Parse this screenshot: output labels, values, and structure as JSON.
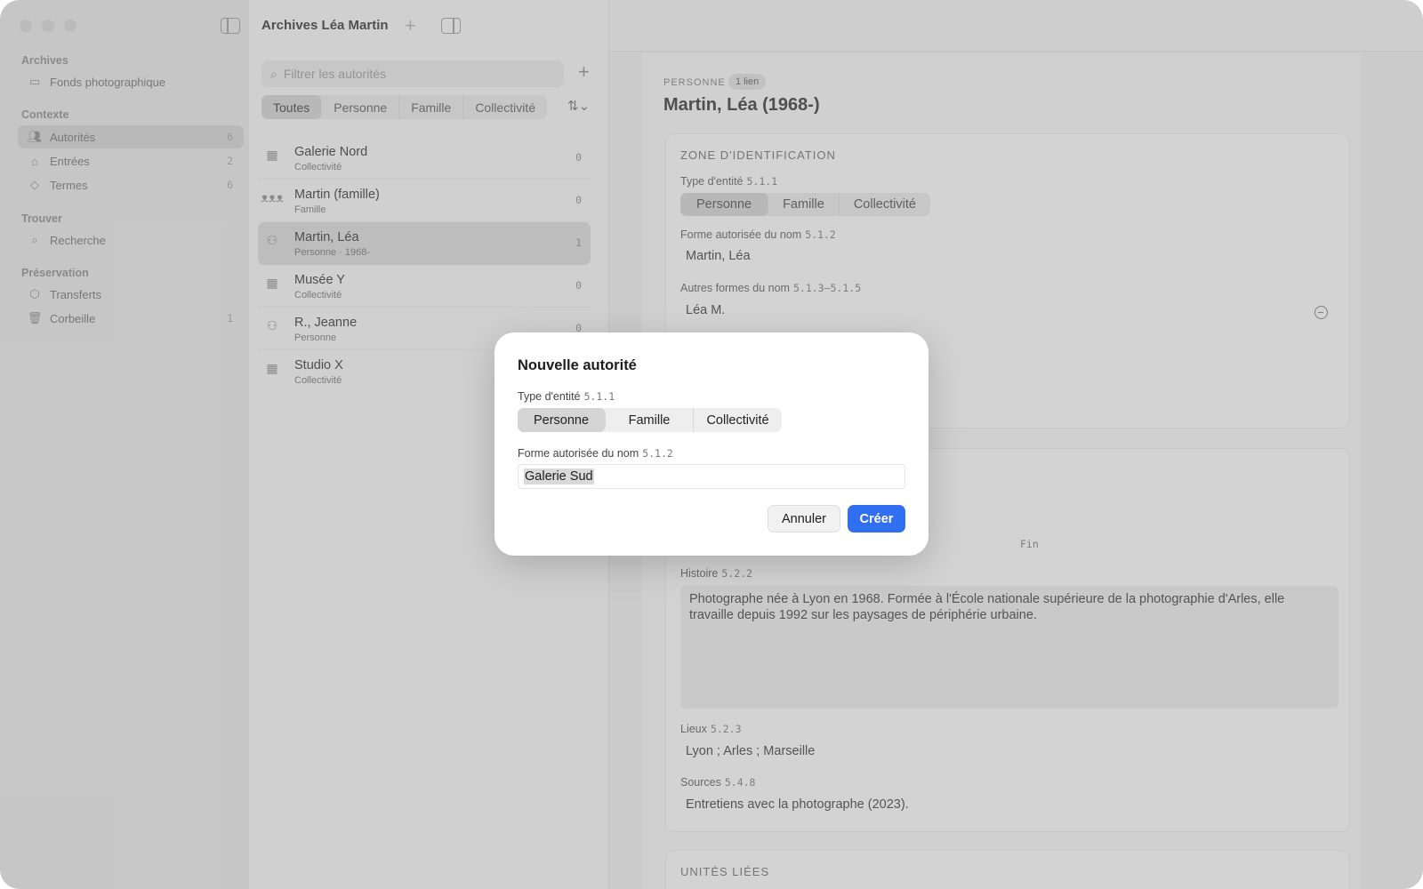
{
  "sidebar": {
    "sections": [
      {
        "title": "Archives",
        "items": [
          {
            "label": "Fonds photographique",
            "icon": "archive-box-icon",
            "count": ""
          }
        ]
      },
      {
        "title": "Contexte",
        "items": [
          {
            "label": "Autorités",
            "icon": "people-icon",
            "count": "6",
            "selected": true
          },
          {
            "label": "Entrées",
            "icon": "inbox-icon",
            "count": "2"
          },
          {
            "label": "Termes",
            "icon": "tag-icon",
            "count": "6"
          }
        ]
      },
      {
        "title": "Trouver",
        "items": [
          {
            "label": "Recherche",
            "icon": "search-icon",
            "count": ""
          }
        ]
      },
      {
        "title": "Préservation",
        "items": [
          {
            "label": "Transferts",
            "icon": "package-icon",
            "count": ""
          },
          {
            "label": "Corbeille",
            "icon": "trash-icon",
            "count": "1"
          }
        ]
      }
    ]
  },
  "list": {
    "window_title": "Archives Léa Martin",
    "search_placeholder": "Filtrer les autorités",
    "filters": [
      "Toutes",
      "Personne",
      "Famille",
      "Collectivité"
    ],
    "active_filter": "Toutes",
    "rows": [
      {
        "name": "Galerie Nord",
        "sub": "Collectivité",
        "count": "0",
        "icon": "building-icon"
      },
      {
        "name": "Martin (famille)",
        "sub": "Famille",
        "count": "0",
        "icon": "family-icon"
      },
      {
        "name": "Martin, Léa",
        "sub": "Personne · 1968-",
        "count": "1",
        "icon": "person-icon",
        "selected": true
      },
      {
        "name": "Musée Y",
        "sub": "Collectivité",
        "count": "0",
        "icon": "building-icon"
      },
      {
        "name": "R., Jeanne",
        "sub": "Personne",
        "count": "0",
        "icon": "person-icon"
      },
      {
        "name": "Studio X",
        "sub": "Collectivité",
        "count": "",
        "icon": "building-icon"
      }
    ]
  },
  "detail": {
    "kind": "PERSONNE",
    "badge": "1 lien",
    "title": "Martin, Léa (1968-)",
    "identification": {
      "heading": "ZONE D'IDENTIFICATION",
      "entity_type_label": "Type d'entité",
      "entity_type_code": "5.1.1",
      "entity_types": [
        "Personne",
        "Famille",
        "Collectivité"
      ],
      "authorized_name_label": "Forme autorisée du nom",
      "authorized_name_code": "5.1.2",
      "authorized_name": "Martin, Léa",
      "other_names_label": "Autres formes du nom",
      "other_names_code": "5.1.3–5.1.5",
      "other_name": "Léa M."
    },
    "description": {
      "end_label": "Fin",
      "history_label": "Histoire",
      "history_code": "5.2.2",
      "history_text": "Photographe née à Lyon en 1968. Formée à l'École nationale supérieure de la photographie d'Arles, elle travaille depuis 1992 sur les paysages de périphérie urbaine.",
      "places_label": "Lieux",
      "places_code": "5.2.3",
      "places": "Lyon ; Arles ; Marseille",
      "sources_label": "Sources",
      "sources_code": "5.4.8",
      "sources": "Entretiens avec la photographe (2023)."
    },
    "linked_heading": "UNITÉS LIÉES"
  },
  "modal": {
    "title": "Nouvelle autorité",
    "entity_type_label": "Type d'entité",
    "entity_type_code": "5.1.1",
    "entity_types": [
      "Personne",
      "Famille",
      "Collectivité"
    ],
    "selected_type": "Personne",
    "name_label": "Forme autorisée du nom",
    "name_code": "5.1.2",
    "name_value": "Galerie Sud",
    "cancel_label": "Annuler",
    "create_label": "Créer"
  },
  "colors": {
    "accent": "#2f6ff0",
    "dim_overlay": "rgba(140,140,140,0.38)"
  }
}
